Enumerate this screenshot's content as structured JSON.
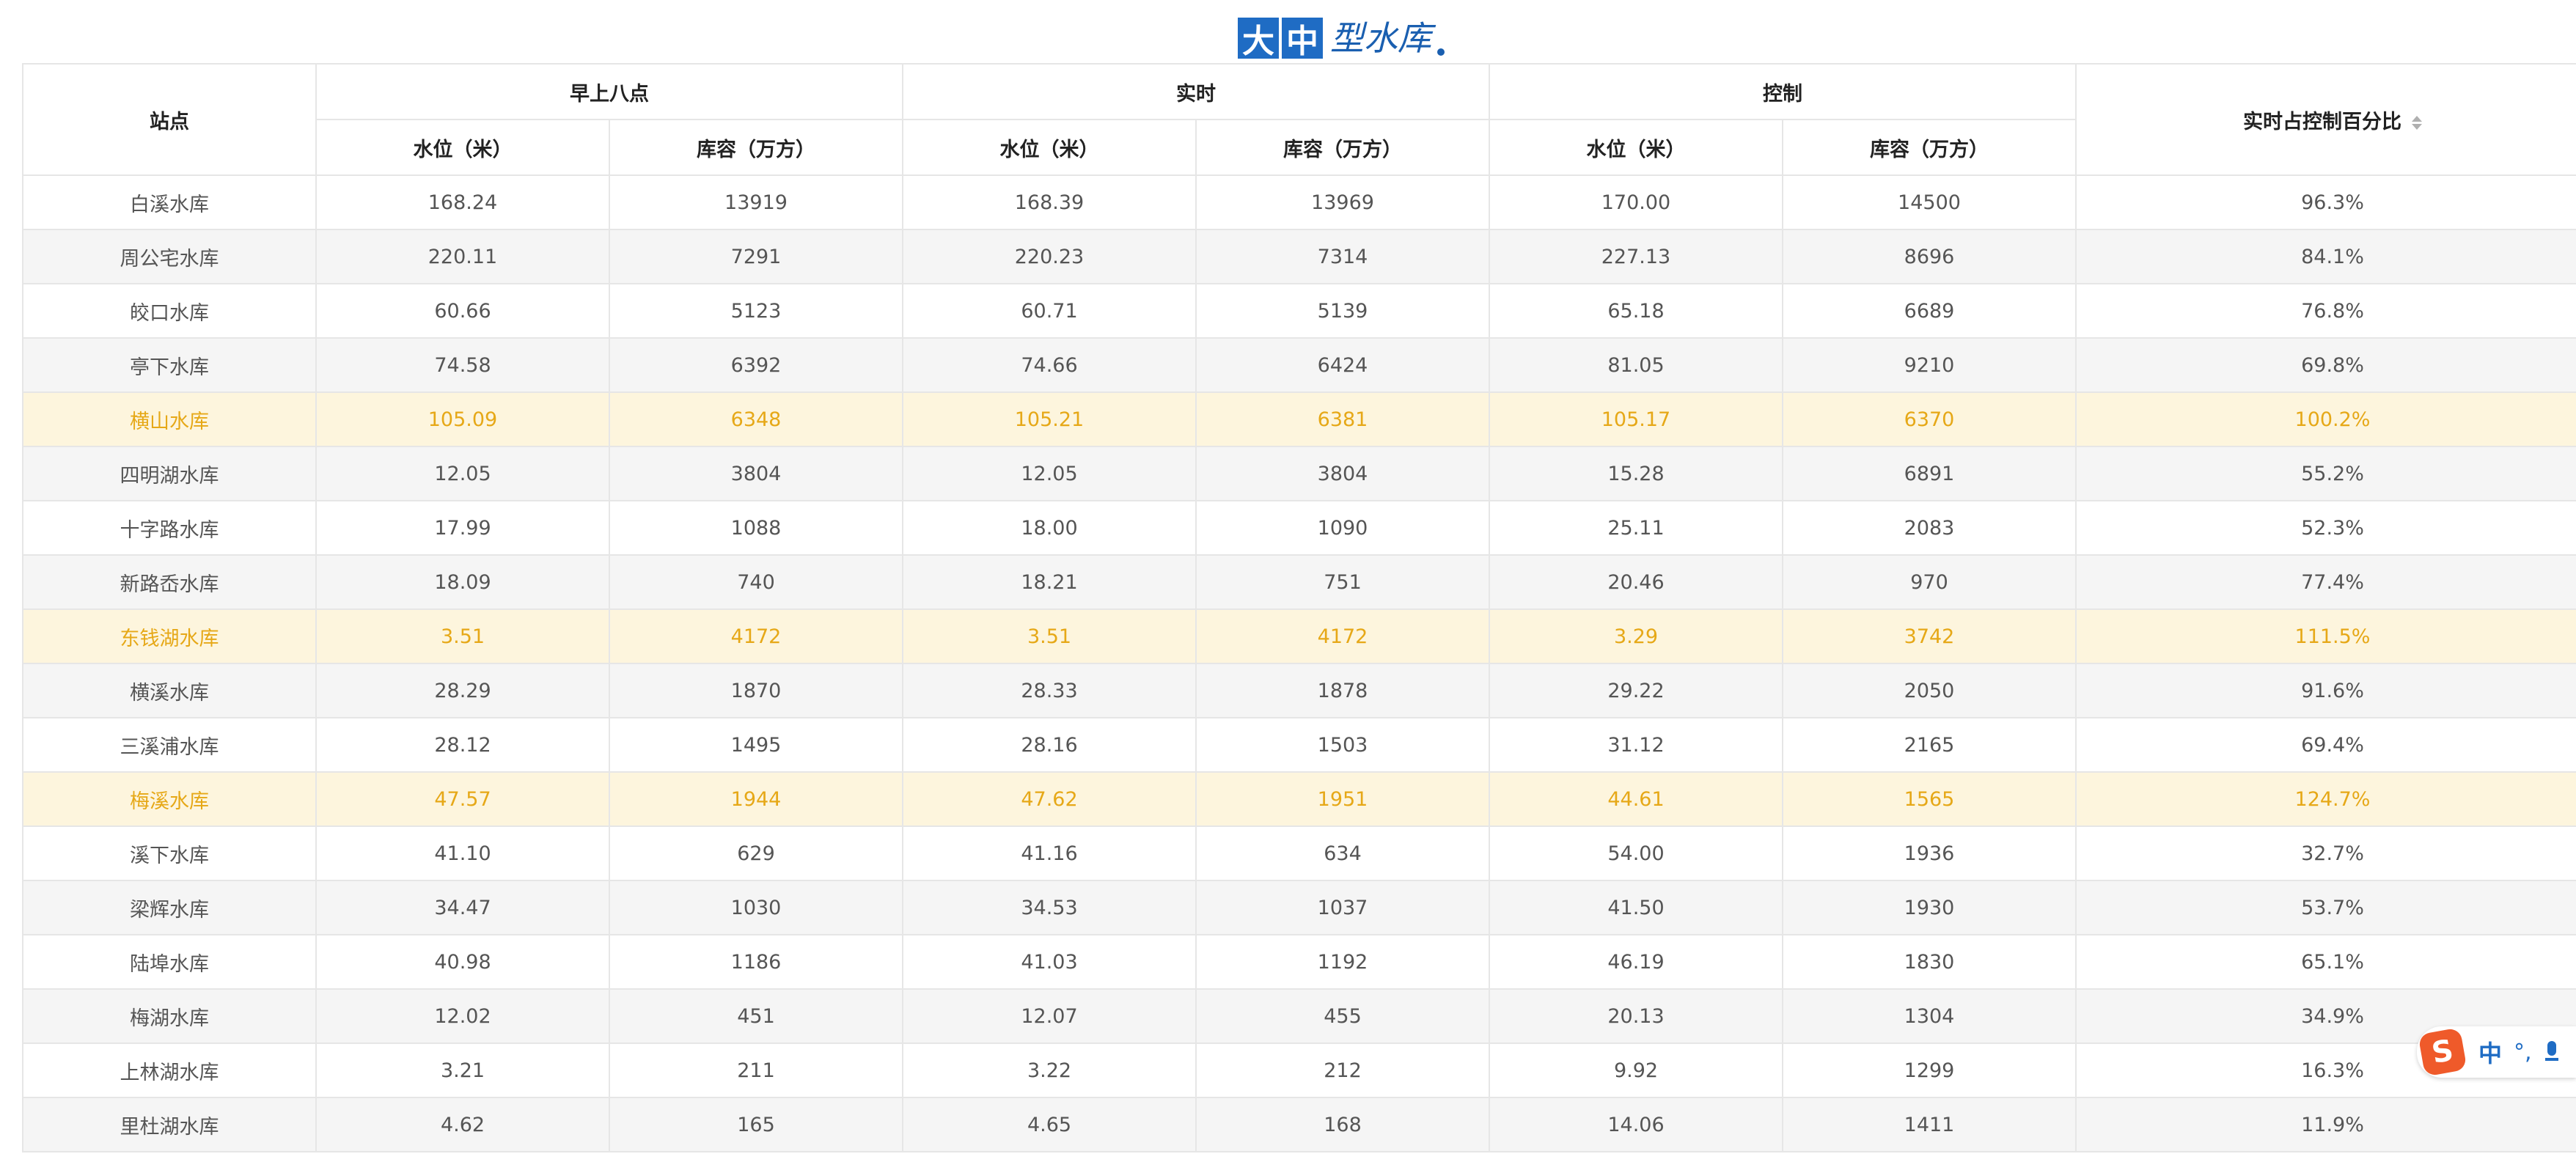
{
  "logo": {
    "char1": "大",
    "char2": "中",
    "rest": "型水库"
  },
  "table": {
    "headers": {
      "station": "站点",
      "group_morning": "早上八点",
      "group_realtime": "实时",
      "group_control": "控制",
      "level": "水位（米）",
      "capacity": "库容（万方）",
      "percent": "实时占控制百分比"
    },
    "rows": [
      {
        "name": "白溪水库",
        "m_level": "168.24",
        "m_cap": "13919",
        "r_level": "168.39",
        "r_cap": "13969",
        "c_level": "170.00",
        "c_cap": "14500",
        "pct": "96.3%"
      },
      {
        "name": "周公宅水库",
        "m_level": "220.11",
        "m_cap": "7291",
        "r_level": "220.23",
        "r_cap": "7314",
        "c_level": "227.13",
        "c_cap": "8696",
        "pct": "84.1%"
      },
      {
        "name": "皎口水库",
        "m_level": "60.66",
        "m_cap": "5123",
        "r_level": "60.71",
        "r_cap": "5139",
        "c_level": "65.18",
        "c_cap": "6689",
        "pct": "76.8%"
      },
      {
        "name": "亭下水库",
        "m_level": "74.58",
        "m_cap": "6392",
        "r_level": "74.66",
        "r_cap": "6424",
        "c_level": "81.05",
        "c_cap": "9210",
        "pct": "69.8%"
      },
      {
        "name": "横山水库",
        "m_level": "105.09",
        "m_cap": "6348",
        "r_level": "105.21",
        "r_cap": "6381",
        "c_level": "105.17",
        "c_cap": "6370",
        "pct": "100.2%"
      },
      {
        "name": "四明湖水库",
        "m_level": "12.05",
        "m_cap": "3804",
        "r_level": "12.05",
        "r_cap": "3804",
        "c_level": "15.28",
        "c_cap": "6891",
        "pct": "55.2%"
      },
      {
        "name": "十字路水库",
        "m_level": "17.99",
        "m_cap": "1088",
        "r_level": "18.00",
        "r_cap": "1090",
        "c_level": "25.11",
        "c_cap": "2083",
        "pct": "52.3%"
      },
      {
        "name": "新路岙水库",
        "m_level": "18.09",
        "m_cap": "740",
        "r_level": "18.21",
        "r_cap": "751",
        "c_level": "20.46",
        "c_cap": "970",
        "pct": "77.4%"
      },
      {
        "name": "东钱湖水库",
        "m_level": "3.51",
        "m_cap": "4172",
        "r_level": "3.51",
        "r_cap": "4172",
        "c_level": "3.29",
        "c_cap": "3742",
        "pct": "111.5%"
      },
      {
        "name": "横溪水库",
        "m_level": "28.29",
        "m_cap": "1870",
        "r_level": "28.33",
        "r_cap": "1878",
        "c_level": "29.22",
        "c_cap": "2050",
        "pct": "91.6%"
      },
      {
        "name": "三溪浦水库",
        "m_level": "28.12",
        "m_cap": "1495",
        "r_level": "28.16",
        "r_cap": "1503",
        "c_level": "31.12",
        "c_cap": "2165",
        "pct": "69.4%"
      },
      {
        "name": "梅溪水库",
        "m_level": "47.57",
        "m_cap": "1944",
        "r_level": "47.62",
        "r_cap": "1951",
        "c_level": "44.61",
        "c_cap": "1565",
        "pct": "124.7%"
      },
      {
        "name": "溪下水库",
        "m_level": "41.10",
        "m_cap": "629",
        "r_level": "41.16",
        "r_cap": "634",
        "c_level": "54.00",
        "c_cap": "1936",
        "pct": "32.7%"
      },
      {
        "name": "梁辉水库",
        "m_level": "34.47",
        "m_cap": "1030",
        "r_level": "34.53",
        "r_cap": "1037",
        "c_level": "41.50",
        "c_cap": "1930",
        "pct": "53.7%"
      },
      {
        "name": "陆埠水库",
        "m_level": "40.98",
        "m_cap": "1186",
        "r_level": "41.03",
        "r_cap": "1192",
        "c_level": "46.19",
        "c_cap": "1830",
        "pct": "65.1%"
      },
      {
        "name": "梅湖水库",
        "m_level": "12.02",
        "m_cap": "451",
        "r_level": "12.07",
        "r_cap": "455",
        "c_level": "20.13",
        "c_cap": "1304",
        "pct": "34.9%"
      },
      {
        "name": "上林湖水库",
        "m_level": "3.21",
        "m_cap": "211",
        "r_level": "3.22",
        "r_cap": "212",
        "c_level": "9.92",
        "c_cap": "1299",
        "pct": "16.3%"
      },
      {
        "name": "里杜湖水库",
        "m_level": "4.62",
        "m_cap": "165",
        "r_level": "4.65",
        "r_cap": "168",
        "c_level": "14.06",
        "c_cap": "1411",
        "pct": "11.9%"
      }
    ]
  },
  "ime": {
    "logo": "S",
    "mode": "中",
    "punct": "°,",
    "mic_icon": "mic-icon"
  },
  "colors": {
    "warning_text": "#e6a817",
    "warning_bg": "#fdf5dd",
    "brand_blue": "#1f6cc4"
  }
}
